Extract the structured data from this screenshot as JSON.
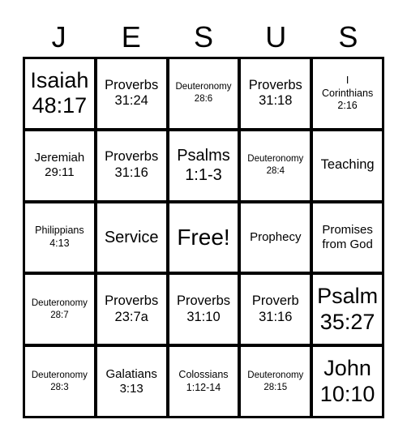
{
  "header": {
    "letters": [
      "J",
      "E",
      "S",
      "U",
      "S"
    ]
  },
  "board": {
    "rows": [
      [
        {
          "lines": [
            "Isaiah",
            "48:17"
          ],
          "size": "xl"
        },
        {
          "lines": [
            "Proverbs",
            "31:24"
          ],
          "size": "md"
        },
        {
          "lines": [
            "Deuteronomy",
            "28:6"
          ],
          "size": "xxs"
        },
        {
          "lines": [
            "Proverbs",
            "31:18"
          ],
          "size": "md"
        },
        {
          "lines": [
            "I",
            "Corinthians",
            "2:16"
          ],
          "size": "xs"
        }
      ],
      [
        {
          "lines": [
            "Jeremiah",
            "29:11"
          ],
          "size": "sm"
        },
        {
          "lines": [
            "Proverbs",
            "31:16"
          ],
          "size": "md"
        },
        {
          "lines": [
            "Psalms",
            "1:1-3"
          ],
          "size": "lg"
        },
        {
          "lines": [
            "Deuteronomy",
            "28:4"
          ],
          "size": "xxs"
        },
        {
          "lines": [
            "Teaching"
          ],
          "size": "md"
        }
      ],
      [
        {
          "lines": [
            "Philippians",
            "4:13"
          ],
          "size": "xs"
        },
        {
          "lines": [
            "Service"
          ],
          "size": "lg"
        },
        {
          "lines": [
            "Free!"
          ],
          "size": "free"
        },
        {
          "lines": [
            "Prophecy"
          ],
          "size": "sm"
        },
        {
          "lines": [
            "Promises",
            "from God"
          ],
          "size": "sm"
        }
      ],
      [
        {
          "lines": [
            "Deuteronomy",
            "28:7"
          ],
          "size": "xxs"
        },
        {
          "lines": [
            "Proverbs",
            "23:7a"
          ],
          "size": "md"
        },
        {
          "lines": [
            "Proverbs",
            "31:10"
          ],
          "size": "md"
        },
        {
          "lines": [
            "Proverb",
            "31:16"
          ],
          "size": "md"
        },
        {
          "lines": [
            "Psalm",
            "35:27"
          ],
          "size": "xl"
        }
      ],
      [
        {
          "lines": [
            "Deuteronomy",
            "28:3"
          ],
          "size": "xxs"
        },
        {
          "lines": [
            "Galatians",
            "3:13"
          ],
          "size": "sm"
        },
        {
          "lines": [
            "Colossians",
            "1:12-14"
          ],
          "size": "xs"
        },
        {
          "lines": [
            "Deuteronomy",
            "28:15"
          ],
          "size": "xxs"
        },
        {
          "lines": [
            "John",
            "10:10"
          ],
          "size": "xl"
        }
      ]
    ]
  }
}
